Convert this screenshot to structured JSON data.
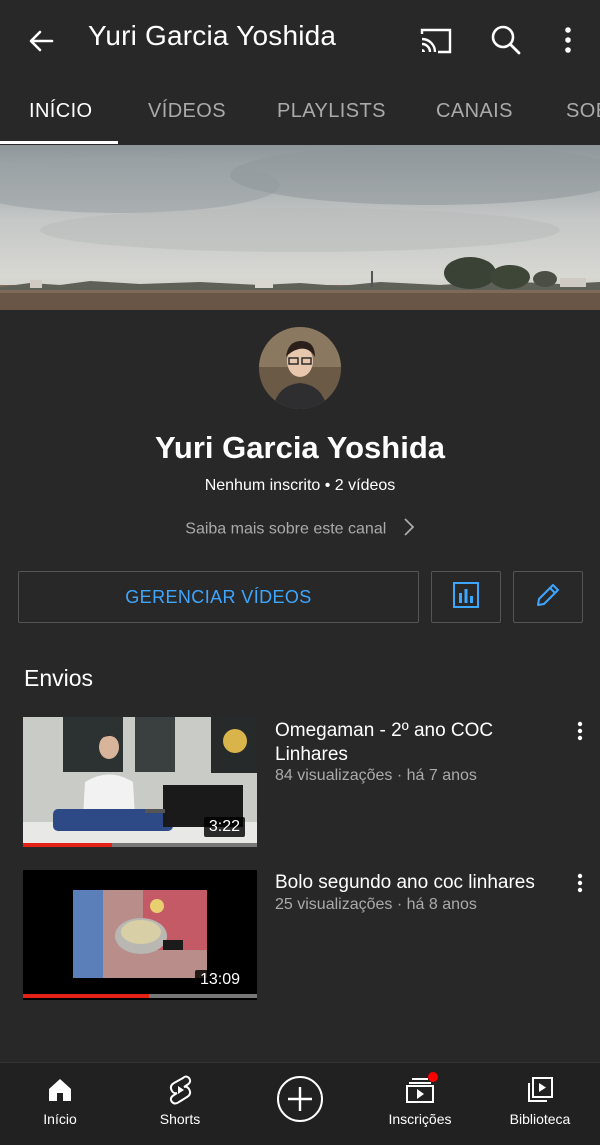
{
  "header": {
    "title": "Yuri Garcia Yoshida",
    "icons": [
      "back-arrow-icon",
      "cast-icon",
      "search-icon",
      "more-vertical-icon"
    ]
  },
  "tabs": [
    {
      "label": "INÍCIO",
      "active": true
    },
    {
      "label": "VÍDEOS",
      "active": false
    },
    {
      "label": "PLAYLISTS",
      "active": false
    },
    {
      "label": "CANAIS",
      "active": false
    },
    {
      "label": "SOBRE",
      "active": false
    }
  ],
  "channel": {
    "name": "Yuri Garcia Yoshida",
    "stats": "Nenhum inscrito • 2 vídeos",
    "about_link": "Saiba mais sobre este canal"
  },
  "actions": {
    "manage_label": "GERENCIAR VÍDEOS",
    "stats_icon": "bar-chart-icon",
    "edit_icon": "pencil-icon"
  },
  "uploads": {
    "title": "Envios",
    "videos": [
      {
        "title": "Omegaman - 2º ano COC Linhares",
        "meta": "84 visualizações · há 7 anos",
        "duration": "3:22",
        "watched_fraction": 0.38
      },
      {
        "title": "Bolo segundo ano coc linhares",
        "meta": "25 visualizações · há 8 anos",
        "duration": "13:09",
        "watched_fraction": 0.54
      }
    ]
  },
  "bottom_nav": [
    {
      "label": "Início",
      "icon": "home-icon",
      "active": true
    },
    {
      "label": "Shorts",
      "icon": "shorts-icon"
    },
    {
      "label": "",
      "icon": "create-plus-icon"
    },
    {
      "label": "Inscrições",
      "icon": "subscriptions-icon",
      "badge": true
    },
    {
      "label": "Biblioteca",
      "icon": "library-icon"
    }
  ],
  "colors": {
    "background": "#282828",
    "accent_blue": "#3ea6ff",
    "progress_red": "#e62117",
    "secondary_text": "#aaaaaa"
  }
}
